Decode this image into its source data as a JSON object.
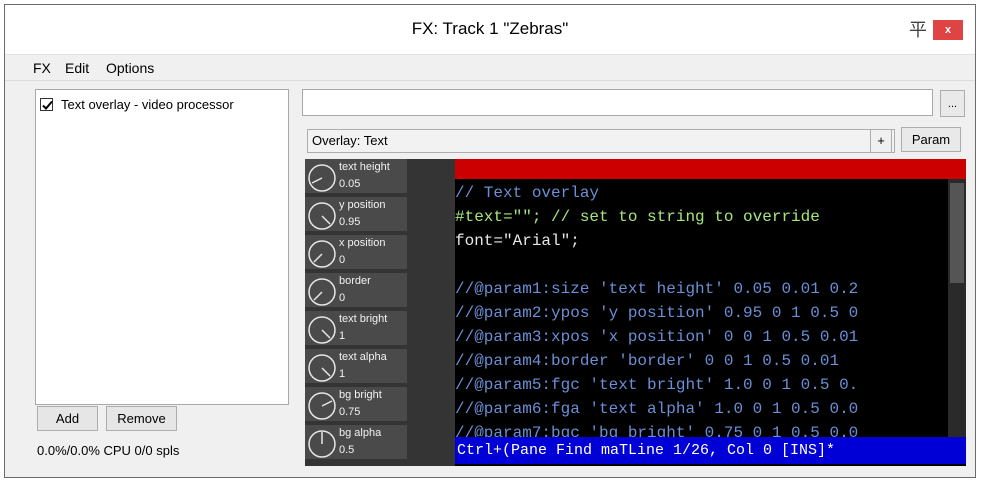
{
  "window": {
    "title": "FX: Track 1 \"Zebras\"",
    "pin_glyph": "平",
    "close_glyph": "x"
  },
  "menu": [
    "FX",
    "Edit",
    "Options"
  ],
  "fx_list": {
    "items": [
      {
        "label": "Text overlay - video processor",
        "checked": true
      }
    ]
  },
  "buttons": {
    "add": "Add",
    "remove": "Remove",
    "ellipsis": "...",
    "plus": "+",
    "param": "Param"
  },
  "cpu_status": "0.0%/0.0% CPU 0/0 spls",
  "path_input": {
    "value": ""
  },
  "overlay_select": {
    "value": "Overlay: Text",
    "chevron": "∨"
  },
  "knobs": [
    {
      "label": "text height",
      "value": "0.05"
    },
    {
      "label": "y position",
      "value": "0.95"
    },
    {
      "label": "x position",
      "value": "0"
    },
    {
      "label": "border",
      "value": "0"
    },
    {
      "label": "text bright",
      "value": "1"
    },
    {
      "label": "text alpha",
      "value": "1"
    },
    {
      "label": "bg bright",
      "value": "0.75"
    },
    {
      "label": "bg alpha",
      "value": "0.5"
    }
  ],
  "code": {
    "lines": [
      "// Text overlay",
      "#text=\"\"; // set to string to override",
      "font=\"Arial\";",
      "",
      "//@param1:size 'text height' 0.05 0.01 0.2",
      "//@param2:ypos 'y position' 0.95 0 1 0.5 0",
      "//@param3:xpos 'x position' 0 0 1 0.5 0.01",
      "//@param4:border 'border' 0 0 1 0.5 0.01",
      "//@param5:fgc 'text bright' 1.0 0 1 0.5 0.",
      "//@param6:fga 'text alpha' 1.0 0 1 0.5 0.0",
      "//@param7:bgc 'bg bright' 0.75 0 1 0.5 0.0"
    ],
    "status": "Ctrl+(Pane Find maTLine 1/26, Col 0 [INS]*"
  },
  "colors": {
    "code_bg": "#000000",
    "code_text": "#6b8fd6",
    "status_bg": "#0000d6",
    "error_bar": "#cc0000",
    "knob_bg": "#4a4a4a",
    "close_btn": "#e04343"
  }
}
